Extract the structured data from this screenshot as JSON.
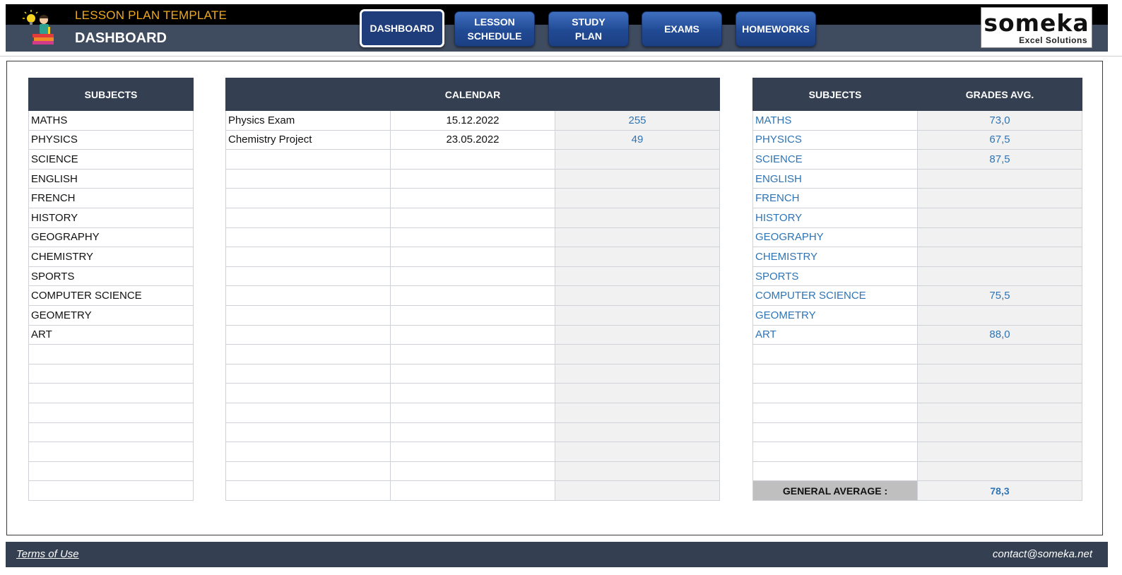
{
  "header": {
    "app_title": "LESSON PLAN TEMPLATE",
    "page_title": "DASHBOARD",
    "brand_name": "someka",
    "brand_sub": "Excel Solutions"
  },
  "nav": [
    {
      "label": "DASHBOARD",
      "active": true
    },
    {
      "label": "LESSON\nSCHEDULE",
      "active": false
    },
    {
      "label": "STUDY\nPLAN",
      "active": false
    },
    {
      "label": "EXAMS",
      "active": false
    },
    {
      "label": "HOMEWORKS",
      "active": false
    }
  ],
  "subjects": {
    "header": "SUBJECTS",
    "items": [
      "MATHS",
      "PHYSICS",
      "SCIENCE",
      "ENGLISH",
      "FRENCH",
      "HISTORY",
      "GEOGRAPHY",
      "CHEMISTRY",
      "SPORTS",
      "COMPUTER SCIENCE",
      "GEOMETRY",
      "ART",
      "",
      "",
      "",
      "",
      "",
      "",
      "",
      ""
    ]
  },
  "calendar": {
    "header": "CALENDAR",
    "rows": [
      {
        "event": "Physics Exam",
        "date": "15.12.2022",
        "days": "255"
      },
      {
        "event": "Chemistry Project",
        "date": "23.05.2022",
        "days": "49"
      },
      {
        "event": "",
        "date": "",
        "days": ""
      },
      {
        "event": "",
        "date": "",
        "days": ""
      },
      {
        "event": "",
        "date": "",
        "days": ""
      },
      {
        "event": "",
        "date": "",
        "days": ""
      },
      {
        "event": "",
        "date": "",
        "days": ""
      },
      {
        "event": "",
        "date": "",
        "days": ""
      },
      {
        "event": "",
        "date": "",
        "days": ""
      },
      {
        "event": "",
        "date": "",
        "days": ""
      },
      {
        "event": "",
        "date": "",
        "days": ""
      },
      {
        "event": "",
        "date": "",
        "days": ""
      },
      {
        "event": "",
        "date": "",
        "days": ""
      },
      {
        "event": "",
        "date": "",
        "days": ""
      },
      {
        "event": "",
        "date": "",
        "days": ""
      },
      {
        "event": "",
        "date": "",
        "days": ""
      },
      {
        "event": "",
        "date": "",
        "days": ""
      },
      {
        "event": "",
        "date": "",
        "days": ""
      },
      {
        "event": "",
        "date": "",
        "days": ""
      },
      {
        "event": "",
        "date": "",
        "days": ""
      }
    ]
  },
  "grades": {
    "header_subjects": "SUBJECTS",
    "header_grades": "GRADES AVG.",
    "rows": [
      {
        "subject": "MATHS",
        "avg": "73,0"
      },
      {
        "subject": "PHYSICS",
        "avg": "67,5"
      },
      {
        "subject": "SCIENCE",
        "avg": "87,5"
      },
      {
        "subject": "ENGLISH",
        "avg": ""
      },
      {
        "subject": "FRENCH",
        "avg": ""
      },
      {
        "subject": "HISTORY",
        "avg": ""
      },
      {
        "subject": "GEOGRAPHY",
        "avg": ""
      },
      {
        "subject": "CHEMISTRY",
        "avg": ""
      },
      {
        "subject": "SPORTS",
        "avg": ""
      },
      {
        "subject": "COMPUTER SCIENCE",
        "avg": "75,5"
      },
      {
        "subject": "GEOMETRY",
        "avg": ""
      },
      {
        "subject": "ART",
        "avg": "88,0"
      },
      {
        "subject": "",
        "avg": ""
      },
      {
        "subject": "",
        "avg": ""
      },
      {
        "subject": "",
        "avg": ""
      },
      {
        "subject": "",
        "avg": ""
      },
      {
        "subject": "",
        "avg": ""
      },
      {
        "subject": "",
        "avg": ""
      },
      {
        "subject": "",
        "avg": ""
      }
    ],
    "general_average_label": "GENERAL AVERAGE :",
    "general_average_value": "78,3"
  },
  "footer": {
    "terms": "Terms of Use",
    "contact": "contact@someka.net"
  },
  "colors": {
    "header_dark": "#343f51",
    "accent_orange": "#f0a81c",
    "value_blue": "#2e74b5",
    "button_blue": "#214a94"
  }
}
